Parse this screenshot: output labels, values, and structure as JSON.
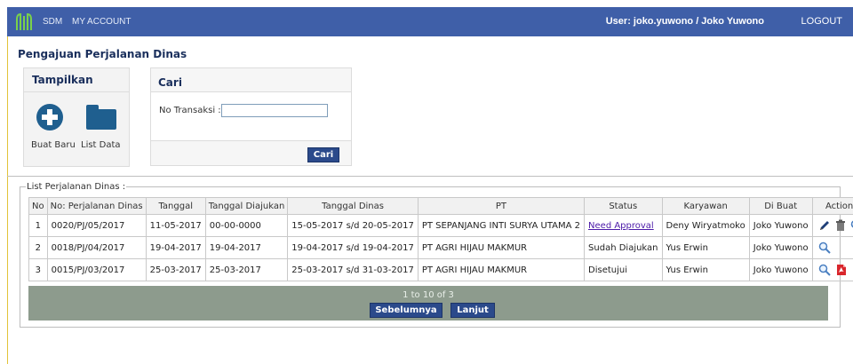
{
  "header": {
    "nav": [
      "SDM",
      "MY ACCOUNT"
    ],
    "user": "User: joko.yuwono / Joko Yuwono",
    "logout": "LOGOUT"
  },
  "page_title": "Pengajuan Perjalanan Dinas",
  "tampilkan": {
    "title": "Tampilkan",
    "buat_baru": "Buat Baru",
    "list_data": "List Data"
  },
  "cari": {
    "title": "Cari",
    "field_label": "No Transaksi :",
    "field_value": "",
    "button": "Cari"
  },
  "list": {
    "legend": "List Perjalanan Dinas :",
    "columns": [
      "No",
      "No: Perjalanan Dinas",
      "Tanggal",
      "Tanggal Diajukan",
      "Tanggal Dinas",
      "PT",
      "Status",
      "Karyawan",
      "Di Buat",
      "Action"
    ],
    "rows": [
      {
        "no": "1",
        "nomor": "0020/PJ/05/2017",
        "tanggal": "11-05-2017",
        "diajukan": "00-00-0000",
        "dinas": "15-05-2017 s/d 20-05-2017",
        "pt": "PT SEPANJANG INTI SURYA UTAMA 2",
        "status": "Need Approval",
        "karyawan": "Deny Wiryatmoko",
        "dibuat": "Joko Yuwono",
        "actions": [
          "edit-icon",
          "trash-icon",
          "search-icon"
        ]
      },
      {
        "no": "2",
        "nomor": "0018/PJ/04/2017",
        "tanggal": "19-04-2017",
        "diajukan": "19-04-2017",
        "dinas": "19-04-2017 s/d 19-04-2017",
        "pt": "PT AGRI HIJAU MAKMUR",
        "status": "Sudah Diajukan",
        "karyawan": "Yus Erwin",
        "dibuat": "Joko Yuwono",
        "actions": [
          "search-icon"
        ]
      },
      {
        "no": "3",
        "nomor": "0015/PJ/03/2017",
        "tanggal": "25-03-2017",
        "diajukan": "25-03-2017",
        "dinas": "25-03-2017 s/d 31-03-2017",
        "pt": "PT AGRI HIJAU MAKMUR",
        "status": "Disetujui",
        "karyawan": "Yus Erwin",
        "dibuat": "Joko Yuwono",
        "actions": [
          "search-icon",
          "pdf-icon"
        ]
      }
    ]
  },
  "pager": {
    "text": "1 to 10 of 3",
    "prev": "Sebelumnya",
    "next": "Lanjut"
  }
}
